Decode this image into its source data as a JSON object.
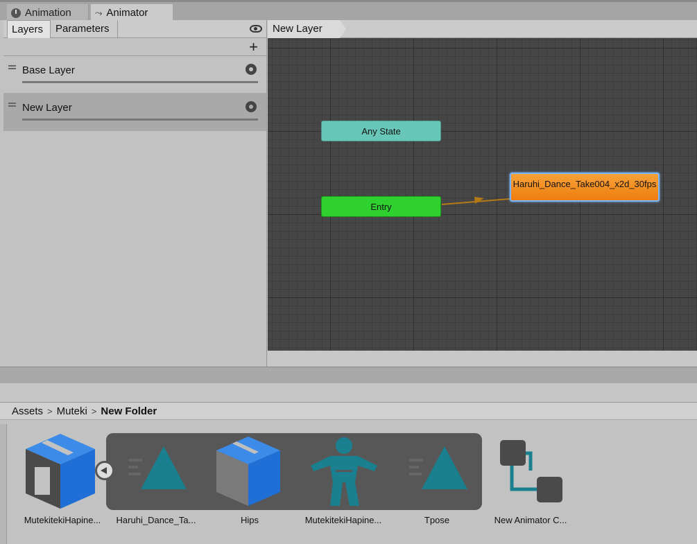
{
  "window_tabs": [
    {
      "label": "Animation",
      "icon": "clock-icon"
    },
    {
      "label": "Animator",
      "icon": "animator-icon"
    }
  ],
  "layers_panel": {
    "tabs": [
      "Layers",
      "Parameters"
    ],
    "layers": [
      {
        "name": "Base Layer",
        "selected": false
      },
      {
        "name": "New Layer",
        "selected": true
      }
    ]
  },
  "graph": {
    "breadcrumb": "New Layer",
    "nodes": {
      "any_state": "Any State",
      "entry": "Entry",
      "state": "Haruhi_Dance_Take004_x2d_30fps"
    },
    "colors": {
      "any_state": "#68c7b8",
      "entry": "#2fd12f",
      "default_state": "#ef7d0d",
      "transition": "#b47a16"
    }
  },
  "project": {
    "breadcrumb": [
      "Assets",
      "Muteki",
      "New Folder"
    ],
    "assets": [
      {
        "label": "MutekitekiHapine...",
        "icon": "prefab-model-icon"
      },
      {
        "label": "Haruhi_Dance_Ta...",
        "icon": "animation-clip-icon"
      },
      {
        "label": "Hips",
        "icon": "gameobject-icon"
      },
      {
        "label": "MutekitekiHapine...",
        "icon": "avatar-icon"
      },
      {
        "label": "Tpose",
        "icon": "animation-clip-icon"
      },
      {
        "label": "New Animator C...",
        "icon": "animator-controller-icon"
      }
    ]
  }
}
